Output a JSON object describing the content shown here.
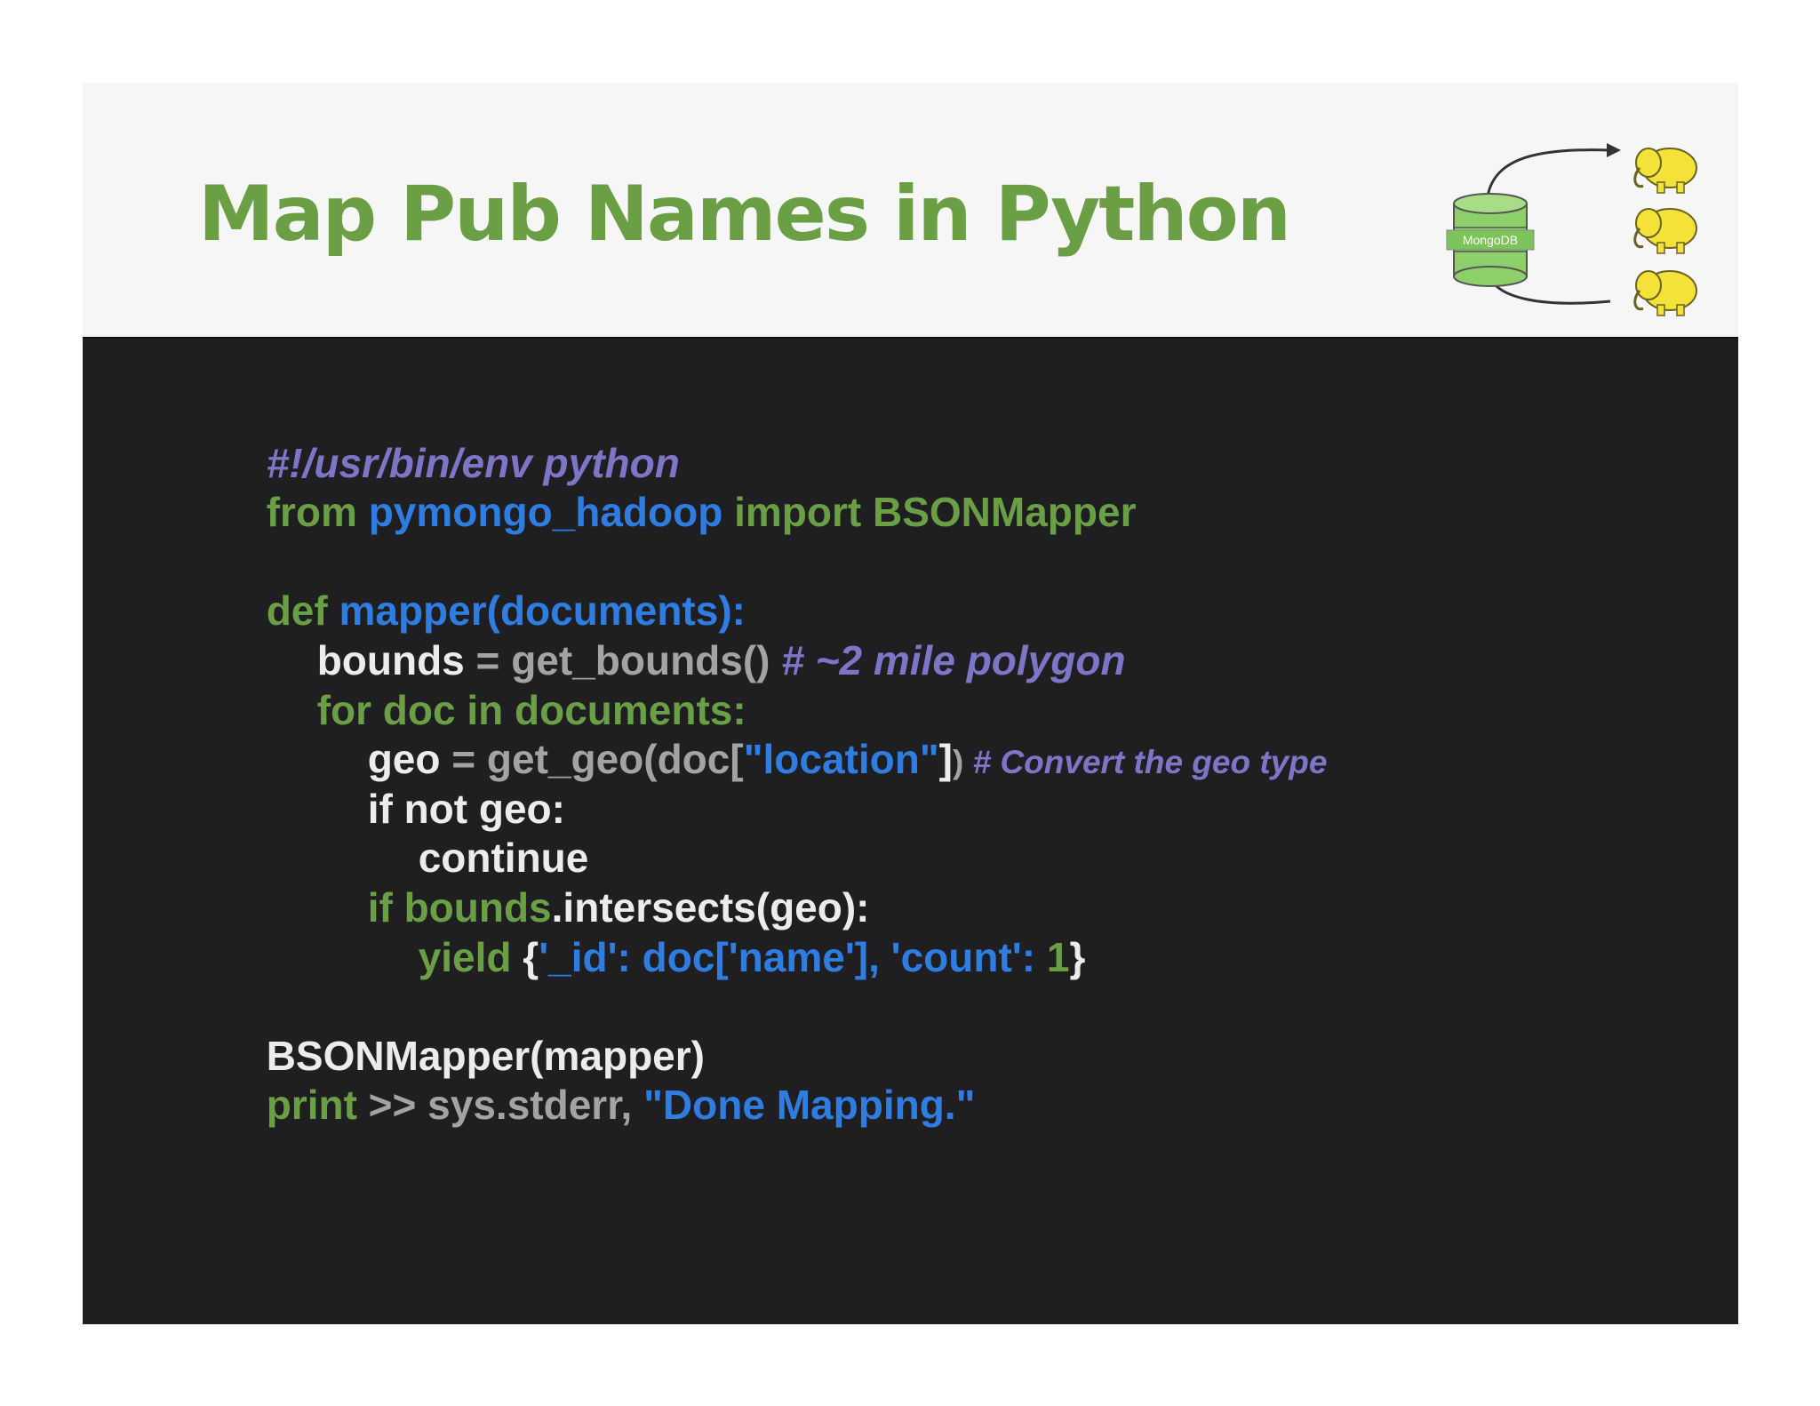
{
  "slide": {
    "title": "Map Pub Names in Python",
    "logo": {
      "db_label": "MongoDB",
      "icons": [
        "database-cylinder-icon",
        "hadoop-elephant-icon",
        "hadoop-elephant-icon",
        "hadoop-elephant-icon",
        "curved-arrow-icon",
        "curved-arrow-icon"
      ],
      "colors": {
        "db_green": "#8fcf6a",
        "elephant_yellow": "#f2e23a",
        "arrow": "#333333"
      }
    }
  },
  "code": {
    "line1": {
      "text": "#!/usr/bin/env python"
    },
    "line2": {
      "kw_from": "from ",
      "module": "pymongo_hadoop",
      "kw_import": " import BSONMapper"
    },
    "line4": {
      "kw_def": "def ",
      "signature": "mapper(documents):"
    },
    "line5": {
      "var": "bounds",
      "assign": " = get_bounds()",
      "comment": " # ~2 mile polygon"
    },
    "line6": {
      "text": "for doc in documents:"
    },
    "line7": {
      "var": "geo",
      "assign": " = get_geo(doc[",
      "key": "\"location\"",
      "close": "]",
      "paren": ")",
      "comment": " # Convert the geo type"
    },
    "line8": {
      "text": "if not geo:"
    },
    "line9": {
      "text": "continue"
    },
    "line10": {
      "kw_if": "if bounds",
      "rest": ".intersects(geo):"
    },
    "line11": {
      "kw_yield": "yield ",
      "brace_open": "{",
      "content": "'_id': doc['name'], 'count': ",
      "number": "1",
      "brace_close": "}"
    },
    "line13": {
      "text": "BSONMapper(mapper)"
    },
    "line14": {
      "kw_print": "print",
      "redirect": " >> sys.stderr, ",
      "string": "\"Done Mapping.\""
    }
  },
  "colors": {
    "keyword_green": "#6a9f45",
    "identifier_blue": "#2f7de0",
    "text_white": "#ececec",
    "text_gray": "#a3a3a3",
    "comment_purple": "#7d76c6",
    "code_background": "#1f1f21",
    "header_background": "#f6f6f6"
  }
}
